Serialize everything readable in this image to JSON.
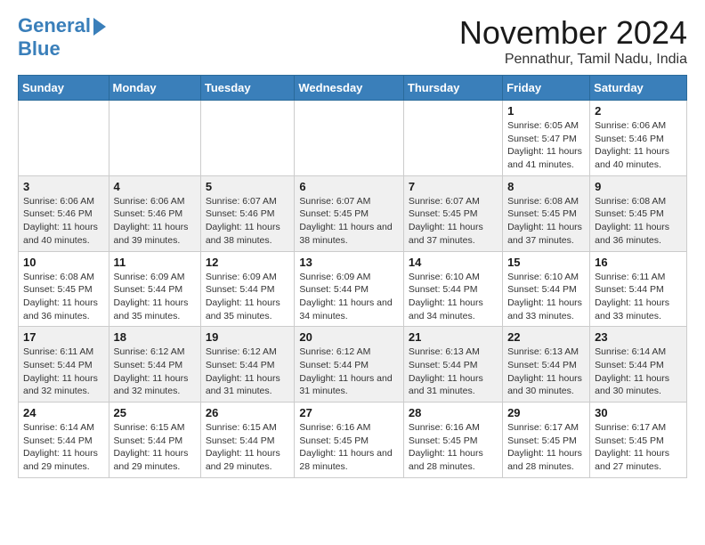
{
  "logo": {
    "line1": "General",
    "line2": "Blue"
  },
  "title": "November 2024",
  "location": "Pennathur, Tamil Nadu, India",
  "days_of_week": [
    "Sunday",
    "Monday",
    "Tuesday",
    "Wednesday",
    "Thursday",
    "Friday",
    "Saturday"
  ],
  "weeks": [
    {
      "shade": "white",
      "days": [
        {
          "num": "",
          "detail": ""
        },
        {
          "num": "",
          "detail": ""
        },
        {
          "num": "",
          "detail": ""
        },
        {
          "num": "",
          "detail": ""
        },
        {
          "num": "",
          "detail": ""
        },
        {
          "num": "1",
          "detail": "Sunrise: 6:05 AM\nSunset: 5:47 PM\nDaylight: 11 hours\nand 41 minutes."
        },
        {
          "num": "2",
          "detail": "Sunrise: 6:06 AM\nSunset: 5:46 PM\nDaylight: 11 hours\nand 40 minutes."
        }
      ]
    },
    {
      "shade": "gray",
      "days": [
        {
          "num": "3",
          "detail": "Sunrise: 6:06 AM\nSunset: 5:46 PM\nDaylight: 11 hours\nand 40 minutes."
        },
        {
          "num": "4",
          "detail": "Sunrise: 6:06 AM\nSunset: 5:46 PM\nDaylight: 11 hours\nand 39 minutes."
        },
        {
          "num": "5",
          "detail": "Sunrise: 6:07 AM\nSunset: 5:46 PM\nDaylight: 11 hours\nand 38 minutes."
        },
        {
          "num": "6",
          "detail": "Sunrise: 6:07 AM\nSunset: 5:45 PM\nDaylight: 11 hours\nand 38 minutes."
        },
        {
          "num": "7",
          "detail": "Sunrise: 6:07 AM\nSunset: 5:45 PM\nDaylight: 11 hours\nand 37 minutes."
        },
        {
          "num": "8",
          "detail": "Sunrise: 6:08 AM\nSunset: 5:45 PM\nDaylight: 11 hours\nand 37 minutes."
        },
        {
          "num": "9",
          "detail": "Sunrise: 6:08 AM\nSunset: 5:45 PM\nDaylight: 11 hours\nand 36 minutes."
        }
      ]
    },
    {
      "shade": "white",
      "days": [
        {
          "num": "10",
          "detail": "Sunrise: 6:08 AM\nSunset: 5:45 PM\nDaylight: 11 hours\nand 36 minutes."
        },
        {
          "num": "11",
          "detail": "Sunrise: 6:09 AM\nSunset: 5:44 PM\nDaylight: 11 hours\nand 35 minutes."
        },
        {
          "num": "12",
          "detail": "Sunrise: 6:09 AM\nSunset: 5:44 PM\nDaylight: 11 hours\nand 35 minutes."
        },
        {
          "num": "13",
          "detail": "Sunrise: 6:09 AM\nSunset: 5:44 PM\nDaylight: 11 hours\nand 34 minutes."
        },
        {
          "num": "14",
          "detail": "Sunrise: 6:10 AM\nSunset: 5:44 PM\nDaylight: 11 hours\nand 34 minutes."
        },
        {
          "num": "15",
          "detail": "Sunrise: 6:10 AM\nSunset: 5:44 PM\nDaylight: 11 hours\nand 33 minutes."
        },
        {
          "num": "16",
          "detail": "Sunrise: 6:11 AM\nSunset: 5:44 PM\nDaylight: 11 hours\nand 33 minutes."
        }
      ]
    },
    {
      "shade": "gray",
      "days": [
        {
          "num": "17",
          "detail": "Sunrise: 6:11 AM\nSunset: 5:44 PM\nDaylight: 11 hours\nand 32 minutes."
        },
        {
          "num": "18",
          "detail": "Sunrise: 6:12 AM\nSunset: 5:44 PM\nDaylight: 11 hours\nand 32 minutes."
        },
        {
          "num": "19",
          "detail": "Sunrise: 6:12 AM\nSunset: 5:44 PM\nDaylight: 11 hours\nand 31 minutes."
        },
        {
          "num": "20",
          "detail": "Sunrise: 6:12 AM\nSunset: 5:44 PM\nDaylight: 11 hours\nand 31 minutes."
        },
        {
          "num": "21",
          "detail": "Sunrise: 6:13 AM\nSunset: 5:44 PM\nDaylight: 11 hours\nand 31 minutes."
        },
        {
          "num": "22",
          "detail": "Sunrise: 6:13 AM\nSunset: 5:44 PM\nDaylight: 11 hours\nand 30 minutes."
        },
        {
          "num": "23",
          "detail": "Sunrise: 6:14 AM\nSunset: 5:44 PM\nDaylight: 11 hours\nand 30 minutes."
        }
      ]
    },
    {
      "shade": "white",
      "days": [
        {
          "num": "24",
          "detail": "Sunrise: 6:14 AM\nSunset: 5:44 PM\nDaylight: 11 hours\nand 29 minutes."
        },
        {
          "num": "25",
          "detail": "Sunrise: 6:15 AM\nSunset: 5:44 PM\nDaylight: 11 hours\nand 29 minutes."
        },
        {
          "num": "26",
          "detail": "Sunrise: 6:15 AM\nSunset: 5:44 PM\nDaylight: 11 hours\nand 29 minutes."
        },
        {
          "num": "27",
          "detail": "Sunrise: 6:16 AM\nSunset: 5:45 PM\nDaylight: 11 hours\nand 28 minutes."
        },
        {
          "num": "28",
          "detail": "Sunrise: 6:16 AM\nSunset: 5:45 PM\nDaylight: 11 hours\nand 28 minutes."
        },
        {
          "num": "29",
          "detail": "Sunrise: 6:17 AM\nSunset: 5:45 PM\nDaylight: 11 hours\nand 28 minutes."
        },
        {
          "num": "30",
          "detail": "Sunrise: 6:17 AM\nSunset: 5:45 PM\nDaylight: 11 hours\nand 27 minutes."
        }
      ]
    }
  ]
}
